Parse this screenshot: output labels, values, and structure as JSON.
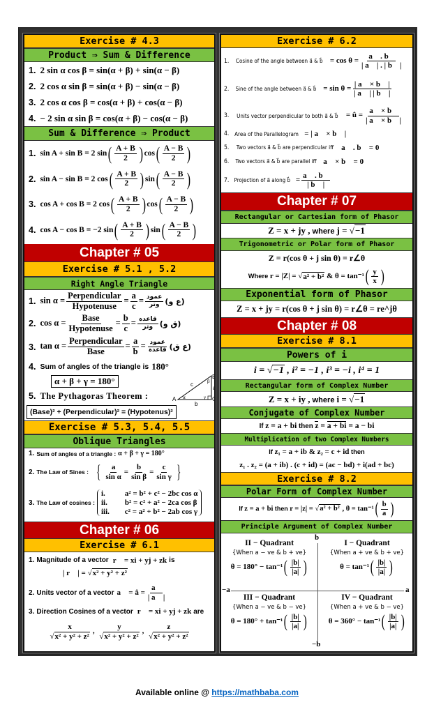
{
  "left": {
    "ex43": {
      "title": "Exercise # 4.3",
      "sub1": "Product ⇒ Sum & Difference",
      "items1": [
        {
          "n": "1.",
          "f": [
            "2 sin α cos β = sin(α + β) + sin(α − β)"
          ]
        },
        {
          "n": "2.",
          "f": [
            "2 cos α sin β = sin(α + β) − sin(α − β)"
          ]
        },
        {
          "n": "3.",
          "f": [
            "2 cos α cos β = cos(α + β) + cos(α − β)"
          ]
        },
        {
          "n": "4.",
          "f": [
            "− 2 sin α sin β = cos(α + β) − cos(α − β)"
          ]
        }
      ],
      "sub2": "Sum & Difference ⇒ Product",
      "items2": [
        {
          "n": "1.",
          "f": [
            "sin A + sin B = 2 sin",
            {
              "pf": [
                "A + B",
                "2"
              ]
            },
            "cos",
            {
              "pf": [
                "A − B",
                "2"
              ]
            }
          ]
        },
        {
          "n": "2.",
          "f": [
            "sin A − sin B = 2 cos",
            {
              "pf": [
                "A + B",
                "2"
              ]
            },
            "sin",
            {
              "pf": [
                "A − B",
                "2"
              ]
            }
          ]
        },
        {
          "n": "3.",
          "f": [
            "cos A + cos B = 2 cos",
            {
              "pf": [
                "A + B",
                "2"
              ]
            },
            "cos",
            {
              "pf": [
                "A − B",
                "2"
              ]
            }
          ]
        },
        {
          "n": "4.",
          "f": [
            "cos A − cos B = −2 sin",
            {
              "pf": [
                "A + B",
                "2"
              ]
            },
            "sin",
            {
              "pf": [
                "A − B",
                "2"
              ]
            }
          ]
        }
      ]
    },
    "ch05": {
      "title": "Chapter # 05",
      "ex1": "Exercise # 5.1 , 5.2",
      "sub1": "Right Angle Triangle",
      "ratios": [
        {
          "n": "1.",
          "f": [
            "sin α =",
            {
              "fr": [
                "Perpendicular",
                "Hypotenuse"
              ]
            },
            "=",
            {
              "fr": [
                "a",
                "c"
              ]
            },
            "="
          ],
          "u": [
            "عمود",
            "وتر"
          ],
          "uab": "(ع و)"
        },
        {
          "n": "2.",
          "f": [
            "cos α =",
            {
              "fr": [
                "Base",
                "Hypotenuse"
              ]
            },
            "=",
            {
              "fr": [
                "b",
                "c"
              ]
            },
            "="
          ],
          "u": [
            "قاعدہ",
            "وتر"
          ],
          "uab": "(ق و)"
        },
        {
          "n": "3.",
          "f": [
            "tan α =",
            {
              "fr": [
                "Perpendicular",
                "Base"
              ]
            },
            "=",
            {
              "fr": [
                "a",
                "b"
              ]
            },
            "="
          ],
          "u": [
            "عمود",
            "قاعدہ"
          ],
          "uab": "(ع ق)"
        }
      ],
      "item4": {
        "n": "4.",
        "label": "Sum of angles of the triangle is",
        "value": "180°",
        "box": "α + β + γ = 180°"
      },
      "item5": {
        "n": "5.",
        "label": "The Pythagoras Theorem :",
        "box": "(Base)² + (Perpendicular)² = (Hypotenus)²"
      },
      "triangle": {
        "A": "A",
        "B": "B",
        "C": "C",
        "a": "a",
        "b": "b",
        "c": "c",
        "alpha": "α",
        "beta": "β",
        "gamma": "γ"
      },
      "ex2": "Exercise # 5.3, 5.4, 5.5",
      "sub2": "Oblique Triangles",
      "obl1": {
        "n": "1.",
        "label": "Sum of angles of a triangle :",
        "f": "α + β + γ = 180°"
      },
      "obl2": {
        "n": "2.",
        "label": "The Law of Sines :",
        "f": [
          {
            "fr": [
              "a",
              "sin α"
            ]
          },
          "=",
          {
            "fr": [
              "b",
              "sin β"
            ]
          },
          "=",
          {
            "fr": [
              "c",
              "sin γ"
            ]
          }
        ]
      },
      "obl3": {
        "n": "3.",
        "label": "The Law of cosines :",
        "rows": [
          {
            "k": "i.",
            "f": "a² = b² + c² − 2bc cos α"
          },
          {
            "k": "ii.",
            "f": "b² = c² + a² − 2ca cos β"
          },
          {
            "k": "iii.",
            "f": "c² = a² + b² − 2ab cos γ"
          }
        ]
      }
    },
    "ch06": {
      "title": "Chapter # 06",
      "ex": "Exercise # 6.1",
      "i1": {
        "n": "1.",
        "label": "Magnitude of a vector",
        "f": "r⃗ = xi + yj + zk",
        "tail": "is",
        "f2": [
          "| r⃗ | = ",
          {
            "sq": "x² + y² + z²"
          }
        ]
      },
      "i2": {
        "n": "2.",
        "label": "Units vector of a vector",
        "f": [
          "a⃗ = â =",
          {
            "fr": [
              "a⃗",
              "| a⃗ |"
            ]
          }
        ]
      },
      "i3": {
        "n": "3.",
        "label": "Direction Cosines of a vector",
        "f": "r⃗ = xi + yj + zk",
        "tail": "are",
        "f2": [
          {
            "fr": [
              "x",
              {
                "sq": "x² + y² + z²"
              }
            ]
          },
          ", ",
          {
            "fr": [
              "y",
              {
                "sq": "x² + y² + z²"
              }
            ]
          },
          ", ",
          {
            "fr": [
              "z",
              {
                "sq": "x² + y² + z²"
              }
            ]
          }
        ]
      }
    }
  },
  "right": {
    "ex62": {
      "title": "Exercise # 6.2",
      "items": [
        {
          "n": "1.",
          "label": "Cosine of the angle between a⃗ & b⃗",
          "f": [
            "= cos θ =",
            {
              "fr": [
                "a⃗ . b⃗",
                "| a⃗ | . | b⃗ |"
              ]
            }
          ]
        },
        {
          "n": "2.",
          "label": "Sine of the angle between a⃗ & b⃗",
          "f": [
            "= sin θ =",
            {
              "fr": [
                "| a⃗ × b⃗ |",
                "| a⃗ | | b⃗ |"
              ]
            }
          ]
        },
        {
          "n": "3.",
          "label": "Units vector perpendicular to both a⃗ & b⃗",
          "f": [
            "= û =",
            {
              "fr": [
                "a⃗ × b⃗",
                "| a⃗ × b⃗ |"
              ]
            }
          ]
        },
        {
          "n": "4.",
          "label": "Area of the Parallelogram",
          "f": [
            "= | a⃗ × b⃗ |"
          ]
        },
        {
          "n": "5.",
          "label": "Two vectors a⃗ & b⃗ are perpendicular iff",
          "f": [
            "a⃗ . b⃗ = 0"
          ]
        },
        {
          "n": "6.",
          "label": "Two vectors a⃗ & b⃗ are parallel iff",
          "f": [
            "a⃗ × b⃗ = 0"
          ]
        },
        {
          "n": "7.",
          "label": "Projection of a⃗ along b⃗",
          "f": [
            "=",
            {
              "fr": [
                "a⃗ . b⃗",
                "| b⃗ |"
              ]
            }
          ]
        }
      ]
    },
    "ch07": {
      "title": "Chapter # 07",
      "h1": "Rectangular or Cartesian form of Phasor",
      "f1": [
        "Z = x + jy ,",
        {
          "t": " where "
        },
        "j = ",
        {
          "sq": "−1"
        }
      ],
      "h2": "Trigonometric or Polar form of Phasor",
      "f2a": "Z = r(cos θ + j sin θ) = r∠θ",
      "f2b": [
        {
          "t": "Where "
        },
        "r = |Z| = ",
        {
          "sq": "a² + b²"
        },
        " & θ = tan⁻¹",
        {
          "pf": [
            "y",
            "x"
          ]
        }
      ],
      "h3": "Exponential form of Phasor",
      "f3": "Z = x + jy = r(cos θ + j sin θ) = r∠θ = re^jθ"
    },
    "ch08": {
      "title": "Chapter # 08",
      "ex1": "Exercise # 8.1",
      "h1": "Powers of i",
      "f1": [
        "i = ",
        {
          "sq": "−1"
        },
        " ,  i² = −1 ,  i³ = −i ,  i⁴ = 1"
      ],
      "h2": "Rectangular form of Complex Number",
      "f2": [
        "Z = x + iy ,",
        {
          "t": " where "
        },
        "i = ",
        {
          "sq": "−1"
        }
      ],
      "h3": "Conjugate of Complex Number",
      "f3": [
        {
          "t": "If "
        },
        "z = a + bi",
        {
          "t": " then "
        },
        {
          "ov": "z"
        },
        " = ",
        {
          "ov": "a + bi"
        },
        " = a − bi"
      ],
      "h4": "Multiplication of two Complex Numbers",
      "f4a": [
        {
          "t": "If  "
        },
        "z₁ = a + ib   &   z₂ = c + id",
        {
          "t": "  then"
        }
      ],
      "f4b": "z₁ . z₂ = (a + ib) . (c + id) = (ac − bd) + i(ad + bc)",
      "ex2": "Exercise # 8.2",
      "h5": "Polar Form of Complex Number",
      "f5": [
        {
          "t": "If "
        },
        "z = a + bi",
        {
          "t": " then "
        },
        "r = |z| = ",
        {
          "sq": "a² + b²"
        },
        " ,  θ = tan⁻¹",
        {
          "pf": [
            "b",
            "a"
          ]
        }
      ],
      "h6": "Principle Argument of Complex Number",
      "axes": {
        "top": "b",
        "bottom": "−b",
        "left": "−a",
        "right": "a"
      },
      "quadrants": [
        {
          "name": "II − Quadrant",
          "when": "{When a − ve & b + ve}",
          "f": [
            "θ = 180° − tan⁻¹",
            {
              "pf": [
                "|b|",
                "|a|"
              ]
            }
          ]
        },
        {
          "name": "I − Quadrant",
          "when": "{When a + ve & b + ve}",
          "f": [
            "θ = tan⁻¹",
            {
              "pf": [
                "|b|",
                "|a|"
              ]
            }
          ]
        },
        {
          "name": "III − Quadrant",
          "when": "{When a − ve & b − ve}",
          "f": [
            "θ = 180° + tan⁻¹",
            {
              "pf": [
                "|b|",
                "|a|"
              ]
            }
          ]
        },
        {
          "name": "IV − Quadrant",
          "when": "{When a + ve & b − ve}",
          "f": [
            "θ = 360° − tan⁻¹",
            {
              "pf": [
                "|b|",
                "|a|"
              ]
            }
          ]
        }
      ]
    }
  },
  "footer": {
    "prefix": "Available online @ ",
    "link": "https://mathbaba.com"
  },
  "colors": {
    "exercise": "#ffc000",
    "subheading": "#7ac143",
    "chapter": "#c00000",
    "link": "#0563c1"
  }
}
